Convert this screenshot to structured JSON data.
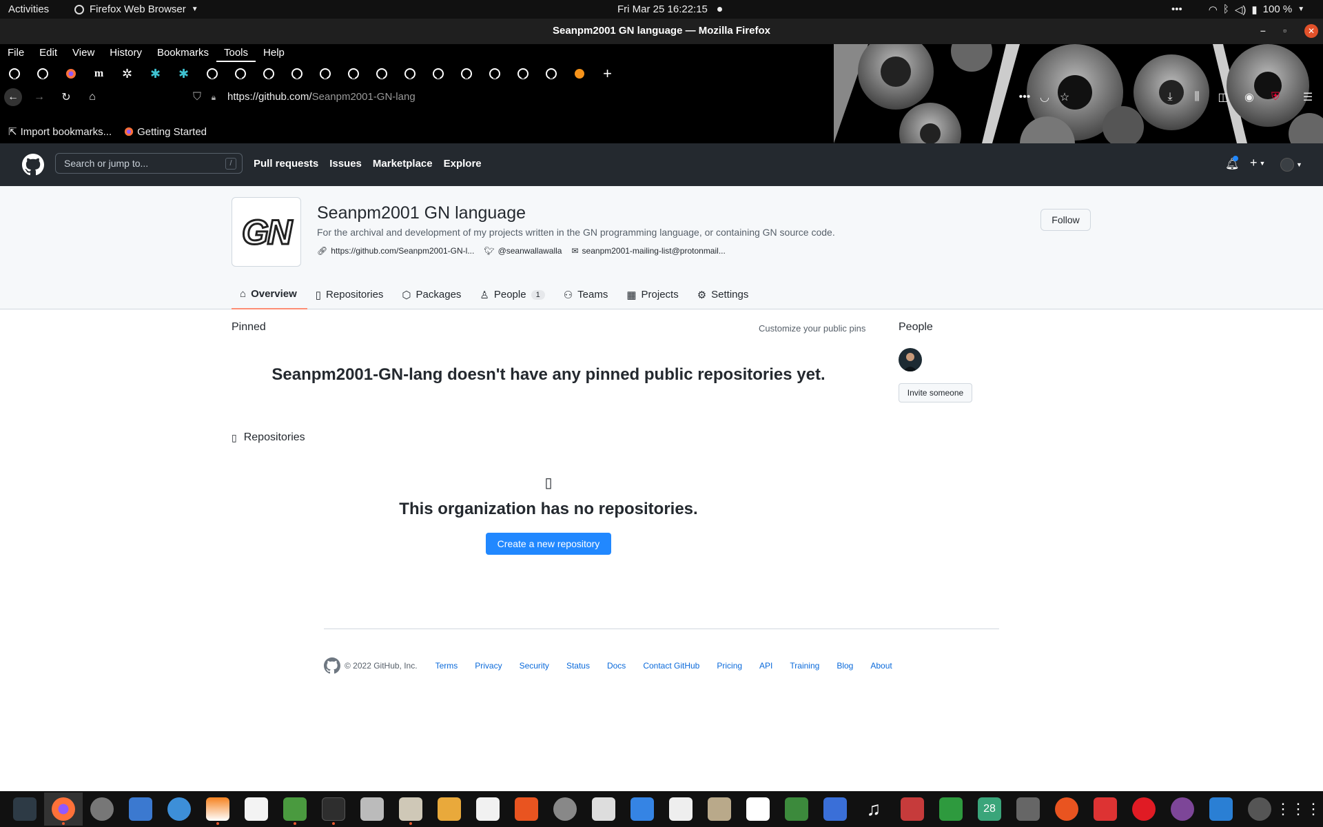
{
  "system": {
    "activities": "Activities",
    "app_menu": "Firefox Web Browser",
    "clock": "Fri Mar 25  16:22:15",
    "battery": "100 %"
  },
  "window": {
    "title": "Seanpm2001 GN language — Mozilla Firefox"
  },
  "menubar": [
    "File",
    "Edit",
    "View",
    "History",
    "Bookmarks",
    "Tools",
    "Help"
  ],
  "address_bar": {
    "url_prefix": "https://github.com/",
    "url_path": "Seanpm2001-GN-lang"
  },
  "bookmarks": [
    {
      "label": "Import bookmarks..."
    },
    {
      "label": "Getting Started"
    }
  ],
  "github_header": {
    "search_placeholder": "Search or jump to...",
    "search_key": "/",
    "nav": [
      "Pull requests",
      "Issues",
      "Marketplace",
      "Explore"
    ]
  },
  "org": {
    "avatar_text": "GN",
    "name": "Seanpm2001 GN language",
    "description": "For the archival and development of my projects written in the GN programming language, or containing GN source code.",
    "website": "https://github.com/Seanpm2001-GN-l...",
    "twitter": "@seanwallawalla",
    "email": "seanpm2001-mailing-list@protonmail...",
    "follow_label": "Follow",
    "tabs": [
      {
        "label": "Overview"
      },
      {
        "label": "Repositories"
      },
      {
        "label": "Packages"
      },
      {
        "label": "People",
        "count": "1"
      },
      {
        "label": "Teams"
      },
      {
        "label": "Projects"
      },
      {
        "label": "Settings"
      }
    ]
  },
  "main": {
    "pinned_title": "Pinned",
    "customize_pins": "Customize your public pins",
    "no_pins_message": "Seanpm2001-GN-lang doesn't have any pinned public repositories yet.",
    "repositories_title": "Repositories",
    "no_repos_message": "This organization has no repositories.",
    "create_repo_label": "Create a new repository"
  },
  "sidebar": {
    "people_title": "People",
    "invite_label": "Invite someone"
  },
  "footer": {
    "copyright": "© 2022 GitHub, Inc.",
    "links": [
      "Terms",
      "Privacy",
      "Security",
      "Status",
      "Docs",
      "Contact GitHub",
      "Pricing",
      "API",
      "Training",
      "Blog",
      "About"
    ]
  },
  "colors": {
    "accent_blue": "#2188ff",
    "tab_underline": "#fd8c73",
    "header_bg": "#24292f"
  }
}
